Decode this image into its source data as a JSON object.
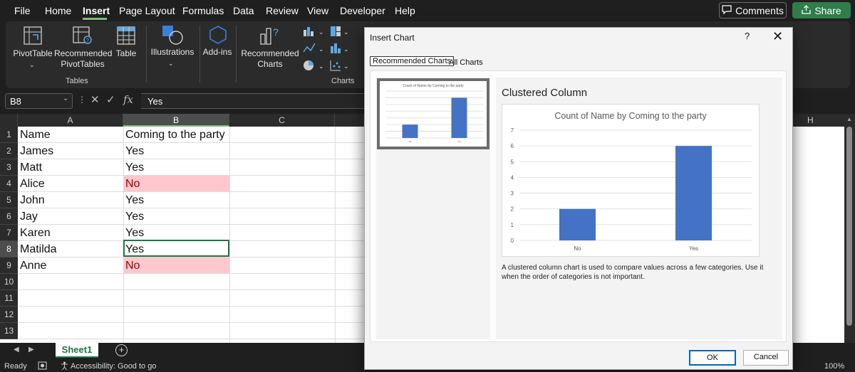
{
  "menu": {
    "items": [
      "File",
      "Home",
      "Insert",
      "Page Layout",
      "Formulas",
      "Data",
      "Review",
      "View",
      "Developer",
      "Help"
    ],
    "active": "Insert",
    "comments_label": "Comments",
    "share_label": "Share"
  },
  "ribbon": {
    "pivottable": "PivotTable",
    "recommended_pivottables": "Recommended PivotTables",
    "table": "Table",
    "tables_group": "Tables",
    "illustrations": "Illustrations",
    "addins": "Add-ins",
    "recommended_charts": "Recommended Charts",
    "charts_group": "Charts"
  },
  "formula_bar": {
    "name_box": "B8",
    "fx": "fx",
    "value": "Yes"
  },
  "sheet": {
    "columns": [
      "A",
      "B",
      "C"
    ],
    "far_column": "H",
    "rows": [
      {
        "num": "1",
        "a": "Name",
        "b": "Coming to the party",
        "highlight": false
      },
      {
        "num": "2",
        "a": "James",
        "b": "Yes",
        "highlight": false
      },
      {
        "num": "3",
        "a": "Matt",
        "b": "Yes",
        "highlight": false
      },
      {
        "num": "4",
        "a": "Alice",
        "b": "No",
        "highlight": true
      },
      {
        "num": "5",
        "a": "John",
        "b": "Yes",
        "highlight": false
      },
      {
        "num": "6",
        "a": "Jay",
        "b": "Yes",
        "highlight": false
      },
      {
        "num": "7",
        "a": "Karen",
        "b": "Yes",
        "highlight": false
      },
      {
        "num": "8",
        "a": "Matilda",
        "b": "Yes",
        "highlight": false
      },
      {
        "num": "9",
        "a": "Anne",
        "b": "No",
        "highlight": true
      },
      {
        "num": "10",
        "a": "",
        "b": "",
        "highlight": false
      },
      {
        "num": "11",
        "a": "",
        "b": "",
        "highlight": false
      },
      {
        "num": "12",
        "a": "",
        "b": "",
        "highlight": false
      },
      {
        "num": "13",
        "a": "",
        "b": "",
        "highlight": false
      }
    ],
    "selected_cell": "B8",
    "highlight_fill": "#ffc7ce",
    "highlight_text": "#9c0006"
  },
  "tabs": {
    "sheet_name": "Sheet1",
    "add_icon": "plus-circle-icon"
  },
  "status": {
    "ready": "Ready",
    "accessibility": "Accessibility: Good to go",
    "zoom": "100%"
  },
  "dialog": {
    "title": "Insert Chart",
    "help": "?",
    "tab_recommended": "Recommended Charts",
    "tab_all": "All Charts",
    "chart_type_name": "Clustered Column",
    "description": "A clustered column chart is used to compare values across a few categories. Use it when the order of categories is not important.",
    "ok_label": "OK",
    "cancel_label": "Cancel"
  },
  "chart_data": {
    "type": "bar",
    "title": "Count of Name by Coming to the party",
    "categories": [
      "No",
      "Yes"
    ],
    "values": [
      2,
      6
    ],
    "ylim": [
      0,
      7
    ],
    "yticks": [
      0,
      1,
      2,
      3,
      4,
      5,
      6,
      7
    ],
    "grid": true,
    "bar_color": "#4472c4"
  }
}
